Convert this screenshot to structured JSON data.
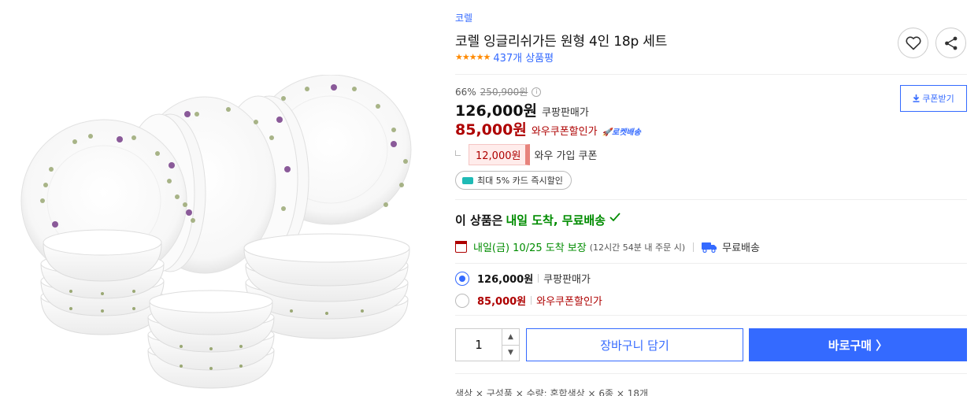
{
  "brand": "코렐",
  "title": "코렐 잉글리쉬가든 원형 4인 18p 세트",
  "rating": {
    "stars": 5,
    "review_count": "437개 상품평"
  },
  "pricing": {
    "discount_percent": "66%",
    "original_price": "250,900원",
    "info_icon": "i",
    "main_price": "126,000원",
    "main_price_label": "쿠팡판매가",
    "wow_price": "85,000원",
    "wow_price_label": "와우쿠폰할인가",
    "rocket_badge": "로켓배송"
  },
  "coupon": {
    "amount": "12,000원",
    "label": "와우 가입 쿠폰",
    "download_label": "쿠폰받기"
  },
  "card_discount": "최대 5% 카드 즉시할인",
  "delivery": {
    "headline_prefix": "이 상품은",
    "headline_highlight": "내일 도착, 무료배송",
    "arrive_text": "내일(금) 10/25 도착 보장",
    "arrive_time": "(12시간 54분 내 주문 시)",
    "free_shipping": "무료배송"
  },
  "options": [
    {
      "price": "126,000원",
      "label": "쿠팡판매가",
      "selected": true
    },
    {
      "price": "85,000원",
      "label": "와우쿠폰할인가",
      "selected": false
    }
  ],
  "quantity": {
    "value": "1"
  },
  "buttons": {
    "cart": "장바구니 담기",
    "buy": "바로구매 〉"
  },
  "footer_text": "색상 × 구성품 × 수량: 혼합색상 × 6종 × 18개",
  "icons": {
    "heart": "heart-icon",
    "share": "share-icon",
    "calendar": "calendar-icon",
    "truck": "truck-icon",
    "card": "card-icon",
    "download": "download-icon"
  },
  "colors": {
    "accent": "#346aff",
    "wow_red": "#ae0000",
    "delivery_green": "#008c00",
    "star": "#ff8a00"
  }
}
